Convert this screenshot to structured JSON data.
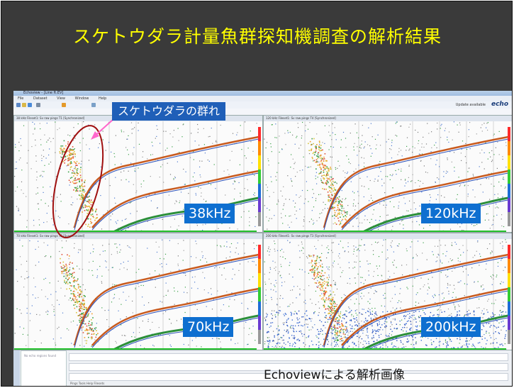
{
  "slide": {
    "title": "スケトウダラ計量魚群探知機調査の解析結果",
    "caption": "Echoviewによる解析画像",
    "callout": "スケトウダラの群れ"
  },
  "app": {
    "window_title": "Echoview - [Line ft.EV]",
    "menu": [
      "File",
      "Dataset",
      "View",
      "Window",
      "Help"
    ],
    "update_text": "Update available",
    "logo": "echo",
    "history_text": "No echo regions found"
  },
  "panels": [
    {
      "id": "p38",
      "header": "38 kHz Fileset1: Sv raw pings T1 [Synchronized]",
      "freq_label": "38kHz"
    },
    {
      "id": "p120",
      "header": "120 kHz Fileset1: Sv raw pings T4 [Synchronized]",
      "freq_label": "120kHz"
    },
    {
      "id": "p70",
      "header": "70 kHz Fileset1: Sv raw pings T2 [Synchronized]",
      "freq_label": "70kHz"
    },
    {
      "id": "p200",
      "header": "200 kHz Fileset1: Sv raw pings T3 [Synchronized]",
      "freq_label": "200kHz"
    }
  ],
  "bottom_tabs": "Pings  Tools  Help  Filesets",
  "colors": {
    "title": "#ffff00",
    "background": "#3a3a3a",
    "label_bg": "#0e6fd0",
    "ellipse": "#a01010",
    "arrow": "#ff66cc"
  }
}
